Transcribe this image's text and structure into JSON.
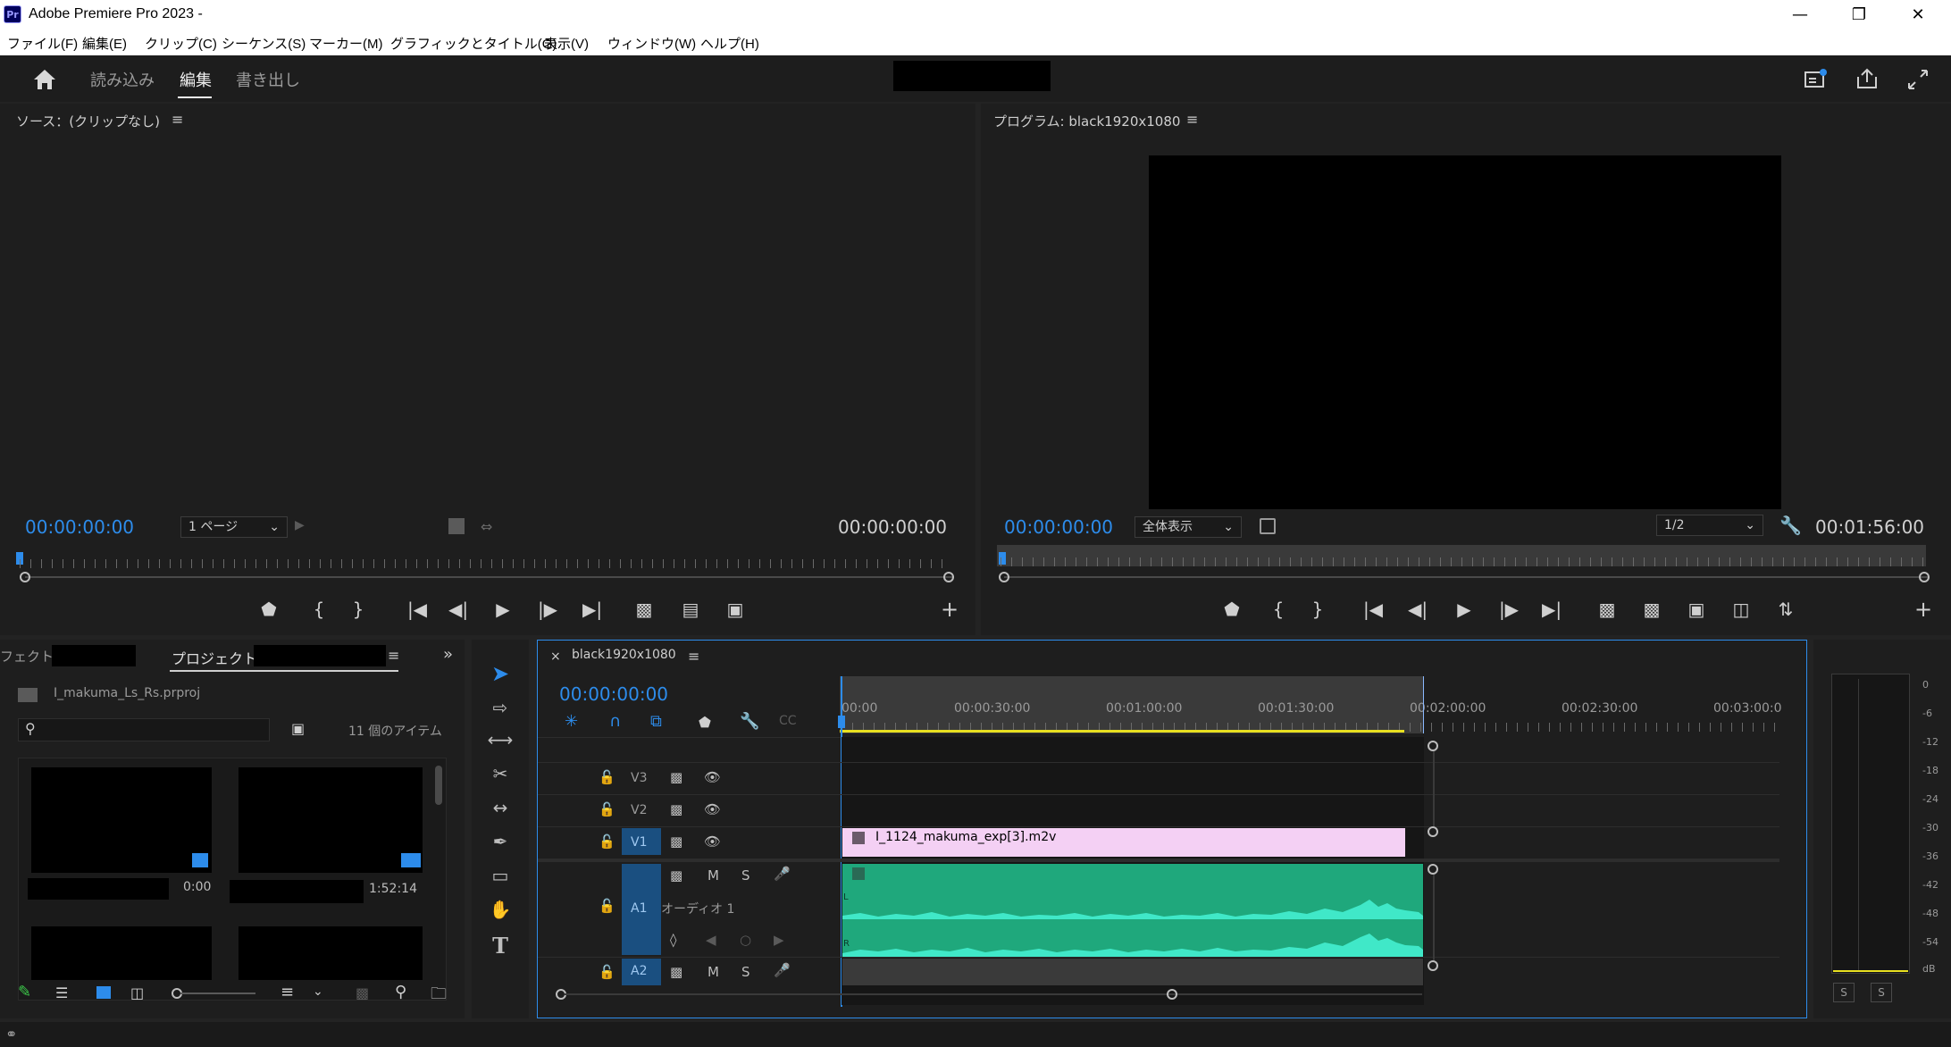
{
  "window": {
    "app_icon": "Pr",
    "title": "Adobe Premiere Pro 2023 -",
    "controls": [
      "minimize-icon",
      "restore-icon",
      "close-icon"
    ]
  },
  "menu": [
    "ファイル(F)",
    "編集(E)",
    "クリップ(C)",
    "シーケンス(S)",
    "マーカー(M)",
    "グラフィックとタイトル(G)",
    "表示(V)",
    "ウィンドウ(W)",
    "ヘルプ(H)"
  ],
  "workspace": {
    "tabs": [
      "読み込み",
      "編集",
      "書き出し"
    ],
    "active_tab": "編集"
  },
  "source_monitor": {
    "title": "ソース：(クリップなし)",
    "timecode_in": "00:00:00:00",
    "page_select": "1 ページ",
    "timecode_out": "00:00:00:00"
  },
  "program_monitor": {
    "title": "プログラム: black1920x1080",
    "timecode_in": "00:00:00:00",
    "zoom_select": "全体表示",
    "resolution_select": "1/2",
    "timecode_out": "00:01:56:00"
  },
  "project_panel": {
    "tab_effects_partial": "フェクト:",
    "tab_project": "プロジェクト",
    "file_name": "I_makuma_Ls_Rs.prproj",
    "item_count": "11 個のアイテム",
    "thumb_durations": [
      "0:00",
      "1:52:14"
    ]
  },
  "timeline": {
    "sequence_name": "black1920x1080",
    "timecode": "00:00:00:00",
    "ruler_labels": [
      "00:00",
      "00:00:30:00",
      "00:01:00:00",
      "00:01:30:00",
      "00:02:00:00",
      "00:02:30:00",
      "00:03:00:0"
    ],
    "video_tracks": [
      "V3",
      "V2",
      "V1"
    ],
    "audio_tracks": [
      "A1",
      "A2"
    ],
    "audio_track_name": "オーディオ 1",
    "track_buttons": {
      "mute": "M",
      "solo": "S"
    },
    "clip_name": "I_1124_makuma_exp[3].m2v",
    "channel_labels": [
      "L",
      "R"
    ],
    "colors": {
      "video_clip": "#f4d0f4",
      "audio_clip": "#1fa87c",
      "waveform": "#40e8c8",
      "accent": "#2d8ceb"
    }
  },
  "audio_meter": {
    "scale": [
      "0",
      "-6",
      "-12",
      "-18",
      "-24",
      "-30",
      "-36",
      "-42",
      "-48",
      "-54",
      "dB"
    ],
    "solo_buttons": [
      "S",
      "S"
    ]
  }
}
